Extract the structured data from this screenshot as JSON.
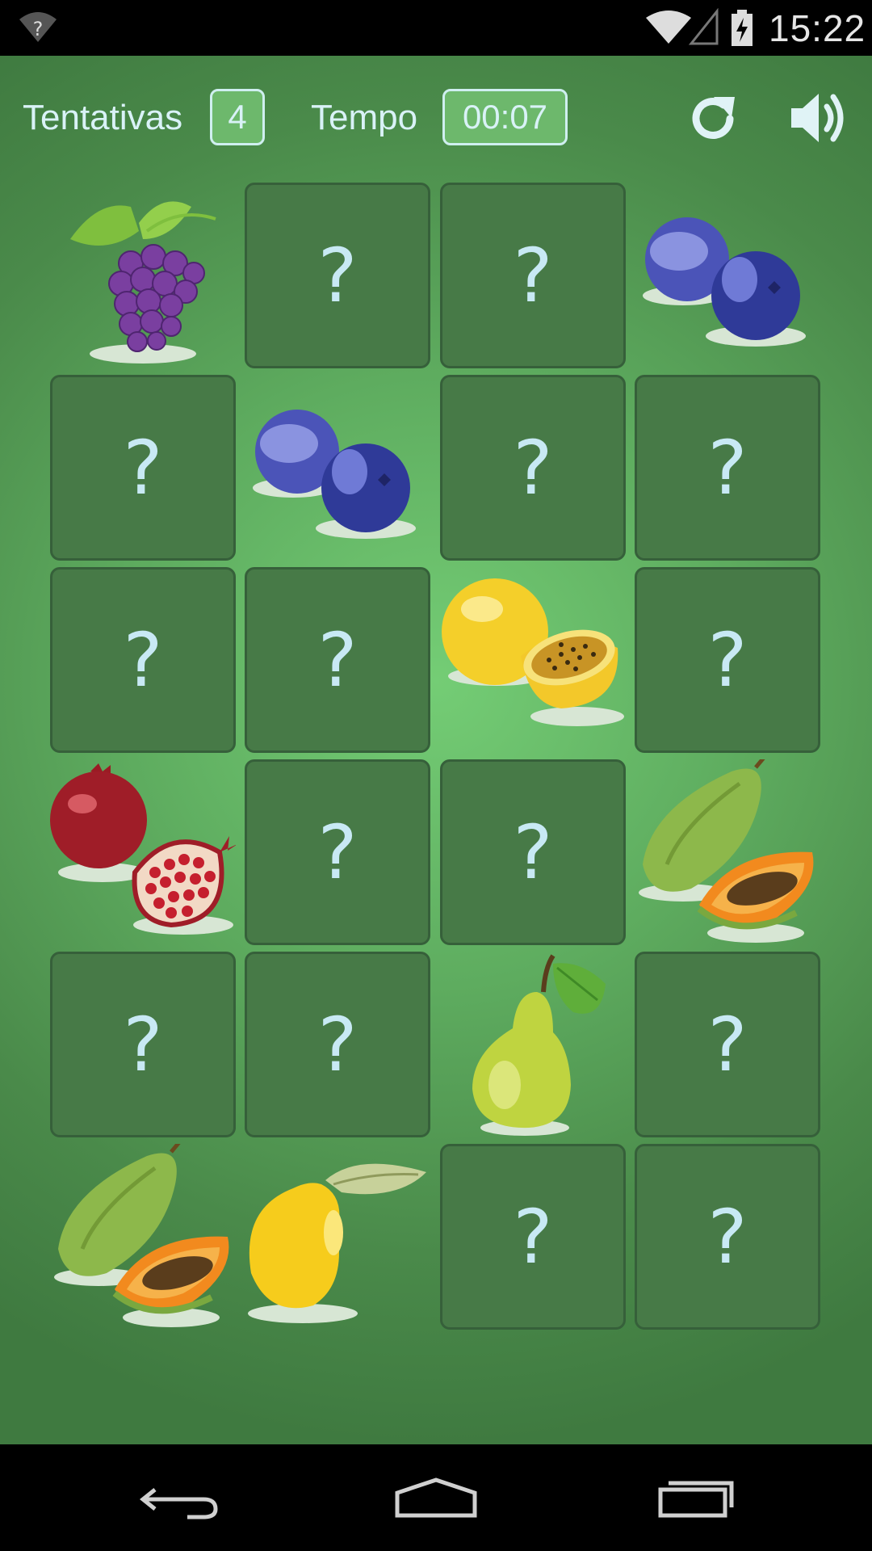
{
  "status_bar": {
    "time": "15:22",
    "icons": [
      "unknown-network-icon",
      "wifi-icon",
      "battery-charging-icon"
    ]
  },
  "hud": {
    "attempts_label": "Tentativas",
    "attempts_value": "4",
    "time_label": "Tempo",
    "time_value": "00:07",
    "icons": [
      "refresh-icon",
      "sound-icon"
    ]
  },
  "board": {
    "hidden_symbol": "?",
    "rows": [
      [
        "grapes",
        "hidden",
        "hidden",
        "blueberries"
      ],
      [
        "hidden",
        "blueberries",
        "hidden",
        "hidden"
      ],
      [
        "hidden",
        "hidden",
        "passion-fruit",
        "hidden"
      ],
      [
        "pomegranate",
        "hidden",
        "hidden",
        "papaya"
      ],
      [
        "hidden",
        "hidden",
        "pear",
        "hidden"
      ],
      [
        "papaya",
        "lemon",
        "hidden",
        "hidden"
      ]
    ]
  },
  "colors": {
    "card": "#477a47",
    "card_border": "#36603a",
    "question_mark": "#c8e9f4",
    "hud_box": "#6db86c"
  },
  "nav_bar": {
    "icons": [
      "back-icon",
      "home-icon",
      "recent-apps-icon"
    ]
  }
}
